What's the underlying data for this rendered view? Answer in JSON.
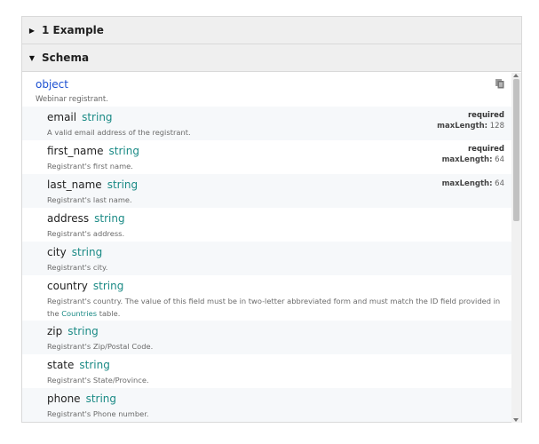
{
  "accordion": {
    "example_label": "1 Example",
    "schema_label": "Schema"
  },
  "schema": {
    "root_type": "object",
    "root_desc": "Webinar registrant.",
    "fields": [
      {
        "name": "email",
        "type": "string",
        "desc": "A valid email address of the registrant.",
        "required": "required",
        "maxlength_label": "maxLength:",
        "maxlength_value": "128"
      },
      {
        "name": "first_name",
        "type": "string",
        "desc": "Registrant's first name.",
        "required": "required",
        "maxlength_label": "maxLength:",
        "maxlength_value": "64"
      },
      {
        "name": "last_name",
        "type": "string",
        "desc": "Registrant's last name.",
        "maxlength_label": "maxLength:",
        "maxlength_value": "64"
      },
      {
        "name": "address",
        "type": "string",
        "desc": "Registrant's address."
      },
      {
        "name": "city",
        "type": "string",
        "desc": "Registrant's city."
      },
      {
        "name": "country",
        "type": "string",
        "desc": "Registrant's country. The value of this field must be in two-letter abbreviated form and must match the ID field provided in the",
        "desc_link": "Countries",
        "desc_tail": " table."
      },
      {
        "name": "zip",
        "type": "string",
        "desc": "Registrant's Zip/Postal Code."
      },
      {
        "name": "state",
        "type": "string",
        "desc": "Registrant's State/Province."
      },
      {
        "name": "phone",
        "type": "string",
        "desc": "Registrant's Phone number."
      }
    ]
  },
  "icons": {
    "expand_collapsed": "caret-right-icon",
    "expand_open": "caret-down-icon",
    "copy": "copy-icon"
  }
}
